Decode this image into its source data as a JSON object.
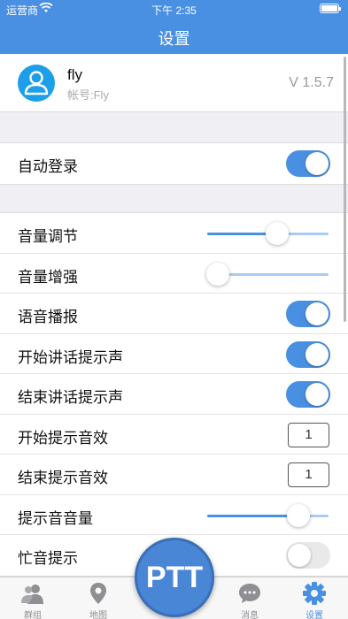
{
  "status_bar": {
    "carrier": "运营商",
    "time": "下午 2:35"
  },
  "nav": {
    "title": "设置"
  },
  "profile": {
    "name": "fly",
    "account": "帐号:Fly",
    "version": "V 1.5.7"
  },
  "settings": {
    "auto_login": {
      "label": "自动登录",
      "on": true
    },
    "volume": {
      "label": "音量调节",
      "level": 0.58
    },
    "volume_boost": {
      "label": "音量增强",
      "level": 0.09
    },
    "voice_broadcast": {
      "label": "语音播报",
      "on": true
    },
    "start_talk_tone": {
      "label": "开始讲话提示声",
      "on": true
    },
    "end_talk_tone": {
      "label": "结束讲话提示声",
      "on": true
    },
    "start_tone_effect": {
      "label": "开始提示音效",
      "value": "1"
    },
    "end_tone_effect": {
      "label": "结束提示音效",
      "value": "1"
    },
    "tone_volume": {
      "label": "提示音音量",
      "level": 0.75
    },
    "busy_tone": {
      "label": "忙音提示",
      "on": false
    }
  },
  "tabbar": {
    "groups": "群组",
    "map": "地图",
    "messages": "消息",
    "settings": "设置",
    "ptt": "PTT"
  },
  "colors": {
    "accent": "#4a90e2",
    "avatar": "#1c9fe8"
  }
}
